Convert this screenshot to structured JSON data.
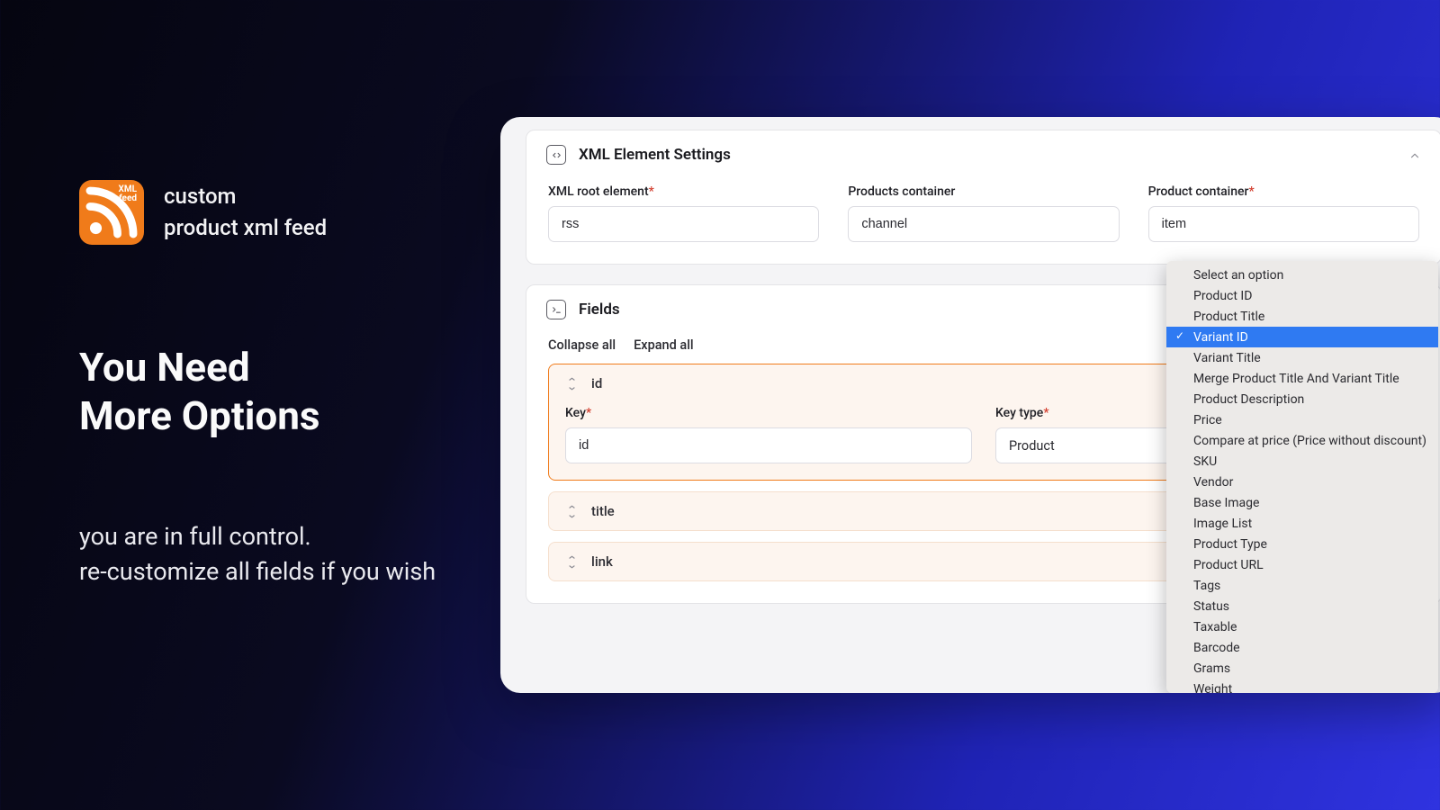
{
  "brand": {
    "line1": "custom",
    "line2": "product xml feed",
    "badge_top": "XML",
    "badge_bottom": "feed"
  },
  "marketing": {
    "headline1": "You Need",
    "headline2": "More Options",
    "sub1": "you are in full control.",
    "sub2": "re-customize all fields if you wish"
  },
  "sections": {
    "xml_settings": {
      "title": "XML Element Settings",
      "fields": {
        "root": {
          "label": "XML root element",
          "value": "rss",
          "required": true
        },
        "products": {
          "label": "Products container",
          "value": "channel",
          "required": false
        },
        "product": {
          "label": "Product container",
          "value": "item",
          "required": true
        }
      }
    },
    "fields_section": {
      "title": "Fields",
      "collapse_label": "Collapse all",
      "expand_label": "Expand all",
      "items": [
        {
          "name": "id",
          "expanded": true,
          "key_label": "Key",
          "key_value": "id",
          "type_label": "Key type",
          "type_value": "Product"
        },
        {
          "name": "title",
          "expanded": false
        },
        {
          "name": "link",
          "expanded": false
        }
      ]
    }
  },
  "dropdown": {
    "selected_index": 3,
    "options": [
      "Select an option",
      "Product ID",
      "Product Title",
      "Variant ID",
      "Variant Title",
      "Merge Product Title And Variant Title",
      "Product Description",
      "Price",
      "Compare at price (Price without discount)",
      "SKU",
      "Vendor",
      "Base Image",
      "Image List",
      "Product Type",
      "Product URL",
      "Tags",
      "Status",
      "Taxable",
      "Barcode",
      "Grams",
      "Weight"
    ]
  }
}
